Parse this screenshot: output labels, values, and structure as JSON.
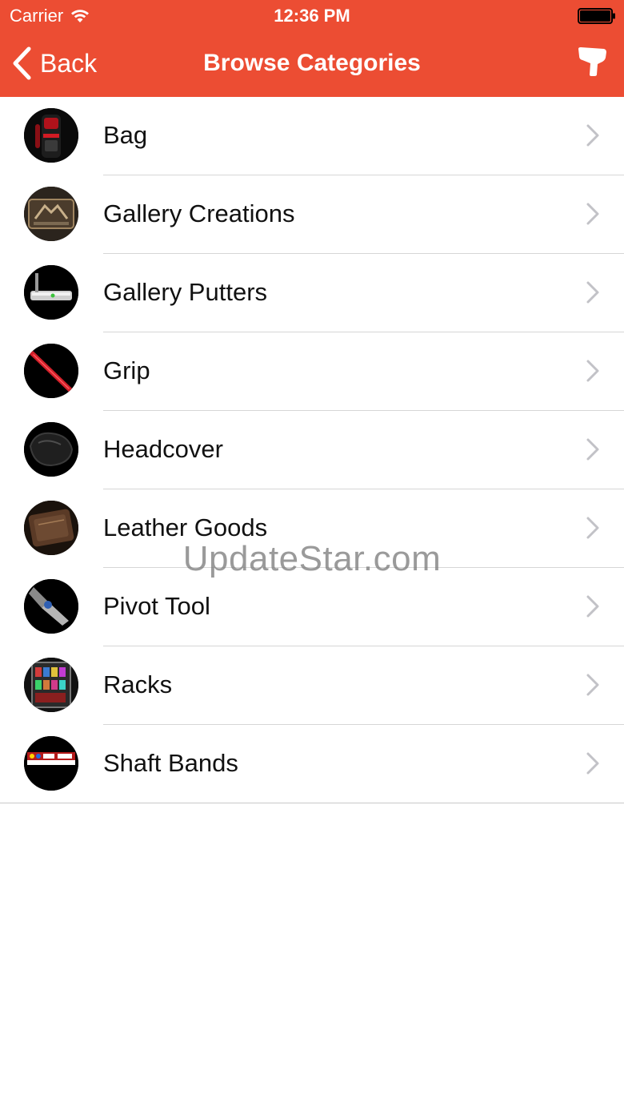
{
  "status_bar": {
    "carrier": "Carrier",
    "time": "12:36 PM"
  },
  "nav": {
    "back_label": "Back",
    "title": "Browse Categories",
    "action_icon": "putter-tool-icon"
  },
  "colors": {
    "accent": "#ec4d33",
    "separator": "#d6d6d6",
    "chevron": "#c2c2c7"
  },
  "categories": [
    {
      "label": "Bag",
      "icon": "bag-thumbnail"
    },
    {
      "label": "Gallery Creations",
      "icon": "gallery-creations-thumbnail"
    },
    {
      "label": "Gallery Putters",
      "icon": "gallery-putters-thumbnail"
    },
    {
      "label": "Grip",
      "icon": "grip-thumbnail"
    },
    {
      "label": "Headcover",
      "icon": "headcover-thumbnail"
    },
    {
      "label": "Leather Goods",
      "icon": "leather-goods-thumbnail"
    },
    {
      "label": "Pivot Tool",
      "icon": "pivot-tool-thumbnail"
    },
    {
      "label": "Racks",
      "icon": "racks-thumbnail"
    },
    {
      "label": "Shaft Bands",
      "icon": "shaft-bands-thumbnail"
    }
  ],
  "watermark": "UpdateStar.com"
}
